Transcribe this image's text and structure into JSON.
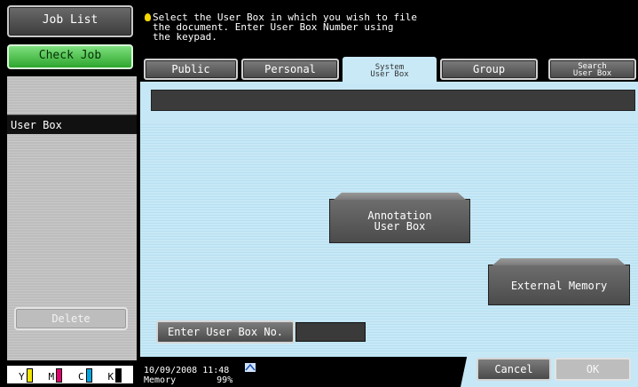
{
  "left_panel": {
    "job_list_label": "Job List",
    "check_job_label": "Check Job",
    "section_label": "User Box",
    "delete_label": "Delete"
  },
  "toner": [
    {
      "label": "Y",
      "color": "#f2e600"
    },
    {
      "label": "M",
      "color": "#e0006f"
    },
    {
      "label": "C",
      "color": "#00a5e0"
    },
    {
      "label": "K",
      "color": "#000000"
    }
  ],
  "message": "Select the User Box in which you wish to file\nthe document.  Enter User Box Number using\nthe keypad.",
  "tabs": {
    "public": "Public",
    "personal": "Personal",
    "system_user_box_line1": "System",
    "system_user_box_line2": "User Box",
    "group": "Group",
    "search_line1": "Search",
    "search_line2": "User Box"
  },
  "boxes": {
    "annotation_line1": "Annotation",
    "annotation_line2": "User Box",
    "external_memory": "External Memory"
  },
  "enter_user_box_label": "Enter User Box No.",
  "enter_user_box_value": "",
  "status": {
    "datetime": "10/09/2008   11:48",
    "memory_label": "Memory",
    "memory_value": "99%"
  },
  "buttons": {
    "cancel": "Cancel",
    "ok": "OK"
  }
}
